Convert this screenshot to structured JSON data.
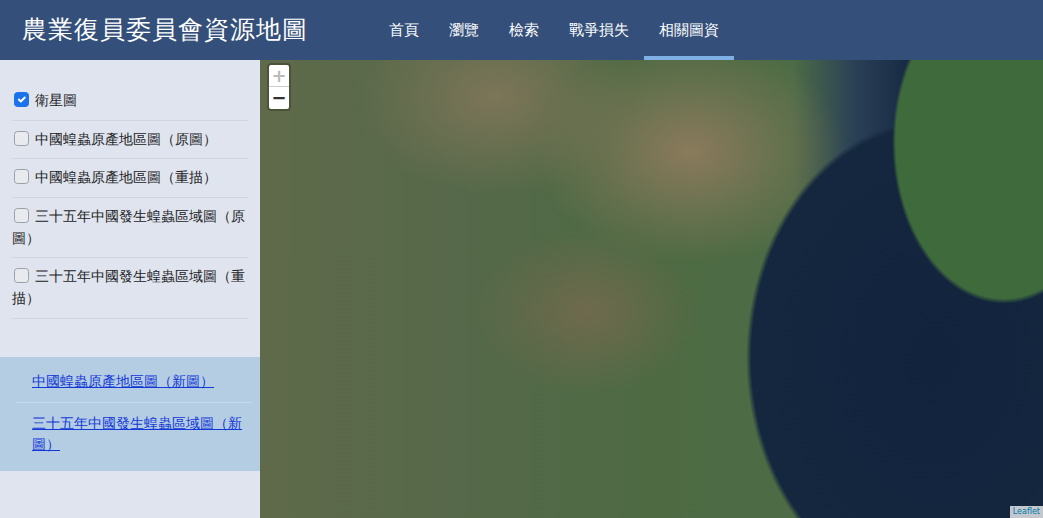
{
  "header": {
    "title": "農業復員委員會資源地圖"
  },
  "nav": [
    {
      "label": "首頁",
      "selected": false
    },
    {
      "label": "瀏覽",
      "selected": false
    },
    {
      "label": "檢索",
      "selected": false
    },
    {
      "label": "戰爭損失",
      "selected": false
    },
    {
      "label": "相關圖資",
      "selected": true
    }
  ],
  "layers": [
    {
      "label": "衛星圖",
      "checked": true
    },
    {
      "label": "中國蝗蟲原產地區圖（原圖）",
      "checked": false
    },
    {
      "label": "中國蝗蟲原產地區圖（重描）",
      "checked": false
    },
    {
      "label": "三十五年中國發生蝗蟲區域圖（原圖）",
      "checked": false
    },
    {
      "label": "三十五年中國發生蝗蟲區域圖（重描）",
      "checked": false
    }
  ],
  "links": [
    {
      "label": "中國蝗蟲原產地區圖（新圖）"
    },
    {
      "label": "三十五年中國發生蝗蟲區域圖（新圖）"
    }
  ],
  "map": {
    "zoom_in": "+",
    "zoom_out": "−",
    "attribution": "Leaflet"
  }
}
